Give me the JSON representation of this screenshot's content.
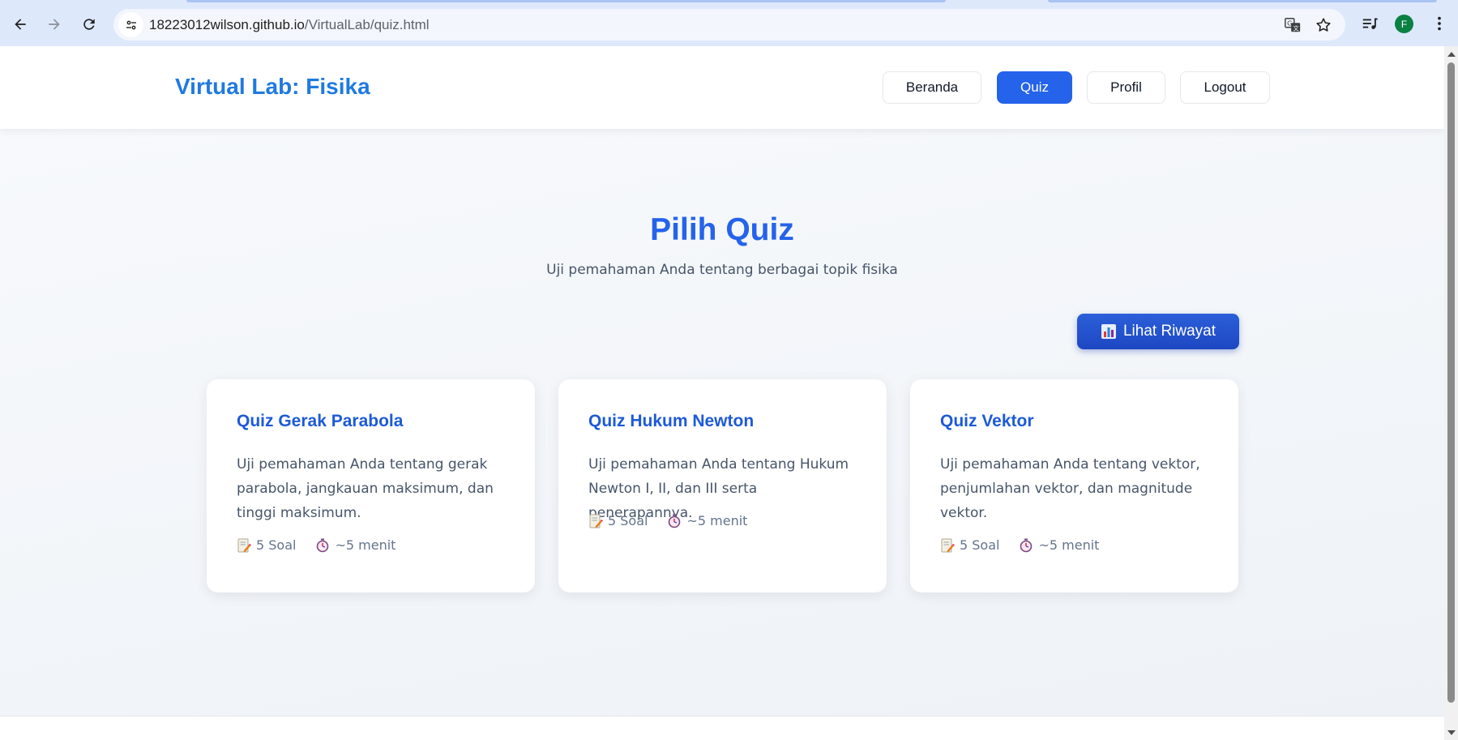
{
  "browser": {
    "url_host": "18223012wilson.github.io",
    "url_path": "/VirtualLab/quiz.html",
    "profile_initial": "F",
    "icons": [
      "back-icon",
      "forward-icon",
      "reload-icon",
      "site-info-icon",
      "translate-icon",
      "bookmark-star-icon",
      "media-controls-icon",
      "menu-kebab-icon"
    ]
  },
  "header": {
    "brand": "Virtual Lab: Fisika",
    "nav": [
      "Beranda",
      "Quiz",
      "Profil",
      "Logout"
    ],
    "active": "Quiz"
  },
  "main": {
    "title": "Pilih Quiz",
    "subtitle": "Uji pemahaman Anda tentang berbagai topik fisika",
    "history_button": "Lihat Riwayat"
  },
  "cards": [
    {
      "title": "Quiz Gerak Parabola",
      "desc": "Uji pemahaman Anda tentang gerak parabola, jangkauan maksimum, dan tinggi maksimum.",
      "questions": "5 Soal",
      "duration": "~5 menit"
    },
    {
      "title": "Quiz Hukum Newton",
      "desc": "Uji pemahaman Anda tentang Hukum Newton I, II, dan III serta penerapannya.",
      "questions": "5 Soal",
      "duration": "~5 menit"
    },
    {
      "title": "Quiz Vektor",
      "desc": "Uji pemahaman Anda tentang vektor, penjumlahan vektor, dan magnitude vektor.",
      "questions": "5 Soal",
      "duration": "~5 menit"
    }
  ],
  "colors": {
    "accent": "#2563eb",
    "brand": "#1f7ae0",
    "chrome": "#dee8fb"
  }
}
